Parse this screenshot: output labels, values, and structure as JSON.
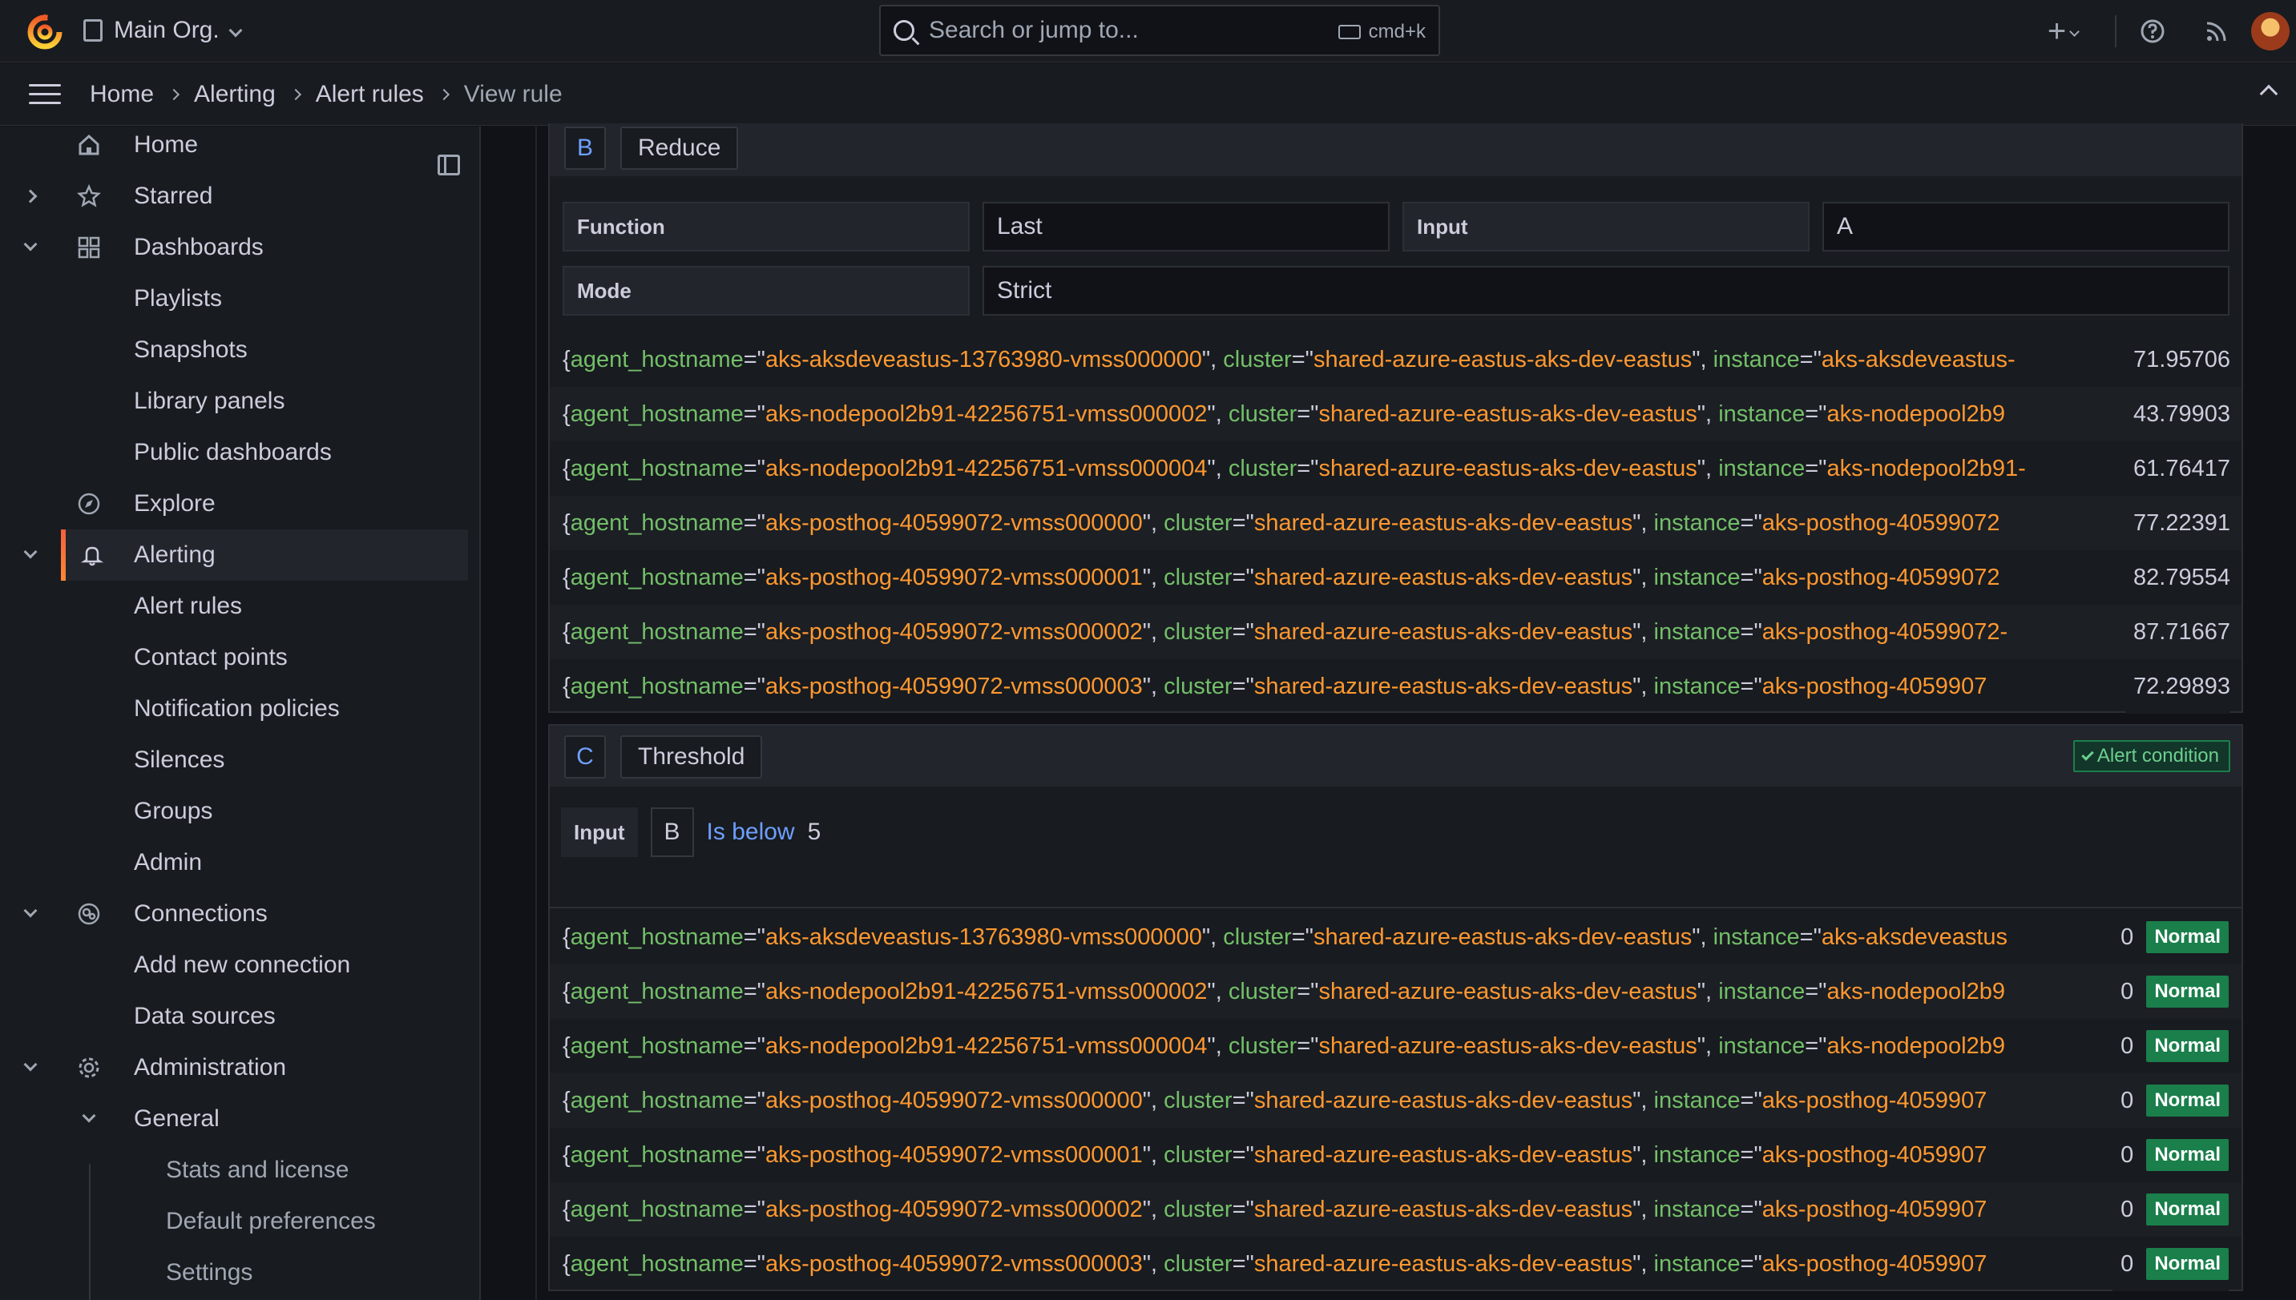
{
  "topbar": {
    "org_name": "Main Org.",
    "search_placeholder": "Search or jump to...",
    "search_shortcut": "cmd+k"
  },
  "breadcrumb": [
    "Home",
    "Alerting",
    "Alert rules",
    "View rule"
  ],
  "sidebar": {
    "items": [
      {
        "label": "Home",
        "icon": "home-icon",
        "level": 0
      },
      {
        "label": "Starred",
        "icon": "star-icon",
        "level": 0,
        "expander": "collapsed"
      },
      {
        "label": "Dashboards",
        "icon": "apps-icon",
        "level": 0,
        "expander": "expanded"
      },
      {
        "label": "Playlists",
        "level": 1
      },
      {
        "label": "Snapshots",
        "level": 1
      },
      {
        "label": "Library panels",
        "level": 1
      },
      {
        "label": "Public dashboards",
        "level": 1
      },
      {
        "label": "Explore",
        "icon": "compass-icon",
        "level": 0
      },
      {
        "label": "Alerting",
        "icon": "bell-icon",
        "level": 0,
        "expander": "expanded",
        "active": true
      },
      {
        "label": "Alert rules",
        "level": 1
      },
      {
        "label": "Contact points",
        "level": 1
      },
      {
        "label": "Notification policies",
        "level": 1
      },
      {
        "label": "Silences",
        "level": 1
      },
      {
        "label": "Groups",
        "level": 1
      },
      {
        "label": "Admin",
        "level": 1
      },
      {
        "label": "Connections",
        "icon": "connections-icon",
        "level": 0,
        "expander": "expanded"
      },
      {
        "label": "Add new connection",
        "level": 1
      },
      {
        "label": "Data sources",
        "level": 1
      },
      {
        "label": "Administration",
        "icon": "cog-icon",
        "level": 0,
        "expander": "expanded"
      },
      {
        "label": "General",
        "level": 1,
        "expander": "expanded"
      },
      {
        "label": "Stats and license",
        "level": 2
      },
      {
        "label": "Default preferences",
        "level": 2
      },
      {
        "label": "Settings",
        "level": 2
      }
    ]
  },
  "reduce": {
    "ref": "B",
    "type": "Reduce",
    "function_label": "Function",
    "function_value": "Last",
    "input_label": "Input",
    "input_value": "A",
    "mode_label": "Mode",
    "mode_value": "Strict",
    "rows": [
      {
        "host": "aks-aksdeveastus-13763980-vmss000000",
        "cluster": "shared-azure-eastus-aks-dev-eastus",
        "instance": "aks-aksdeveastus-",
        "value": "71.95706"
      },
      {
        "host": "aks-nodepool2b91-42256751-vmss000002",
        "cluster": "shared-azure-eastus-aks-dev-eastus",
        "instance": "aks-nodepool2b9",
        "value": "43.79903"
      },
      {
        "host": "aks-nodepool2b91-42256751-vmss000004",
        "cluster": "shared-azure-eastus-aks-dev-eastus",
        "instance": "aks-nodepool2b91-",
        "value": "61.76417"
      },
      {
        "host": "aks-posthog-40599072-vmss000000",
        "cluster": "shared-azure-eastus-aks-dev-eastus",
        "instance": "aks-posthog-40599072",
        "value": "77.22391"
      },
      {
        "host": "aks-posthog-40599072-vmss000001",
        "cluster": "shared-azure-eastus-aks-dev-eastus",
        "instance": "aks-posthog-40599072",
        "value": "82.79554"
      },
      {
        "host": "aks-posthog-40599072-vmss000002",
        "cluster": "shared-azure-eastus-aks-dev-eastus",
        "instance": "aks-posthog-40599072-",
        "value": "87.71667"
      },
      {
        "host": "aks-posthog-40599072-vmss000003",
        "cluster": "shared-azure-eastus-aks-dev-eastus",
        "instance": "aks-posthog-4059907",
        "value": "72.29893"
      }
    ]
  },
  "threshold": {
    "ref": "C",
    "type": "Threshold",
    "alert_condition": "Alert condition",
    "input_label": "Input",
    "input_ref": "B",
    "operator": "Is below",
    "operand": "5",
    "rows": [
      {
        "host": "aks-aksdeveastus-13763980-vmss000000",
        "cluster": "shared-azure-eastus-aks-dev-eastus",
        "instance": "aks-aksdeveastus",
        "value": "0",
        "state": "Normal"
      },
      {
        "host": "aks-nodepool2b91-42256751-vmss000002",
        "cluster": "shared-azure-eastus-aks-dev-eastus",
        "instance": "aks-nodepool2b9",
        "value": "0",
        "state": "Normal"
      },
      {
        "host": "aks-nodepool2b91-42256751-vmss000004",
        "cluster": "shared-azure-eastus-aks-dev-eastus",
        "instance": "aks-nodepool2b9",
        "value": "0",
        "state": "Normal"
      },
      {
        "host": "aks-posthog-40599072-vmss000000",
        "cluster": "shared-azure-eastus-aks-dev-eastus",
        "instance": "aks-posthog-4059907",
        "value": "0",
        "state": "Normal"
      },
      {
        "host": "aks-posthog-40599072-vmss000001",
        "cluster": "shared-azure-eastus-aks-dev-eastus",
        "instance": "aks-posthog-4059907",
        "value": "0",
        "state": "Normal"
      },
      {
        "host": "aks-posthog-40599072-vmss000002",
        "cluster": "shared-azure-eastus-aks-dev-eastus",
        "instance": "aks-posthog-4059907",
        "value": "0",
        "state": "Normal"
      },
      {
        "host": "aks-posthog-40599072-vmss000003",
        "cluster": "shared-azure-eastus-aks-dev-eastus",
        "instance": "aks-posthog-4059907",
        "value": "0",
        "state": "Normal"
      }
    ]
  },
  "label_keys": {
    "host": "agent_hostname",
    "cluster": "cluster",
    "instance": "instance"
  },
  "colors": {
    "label_key": "#73bf69",
    "label_value": "#ff9830",
    "normal_state": "#1a7f4b",
    "accent_ref": "#6e9fff"
  }
}
